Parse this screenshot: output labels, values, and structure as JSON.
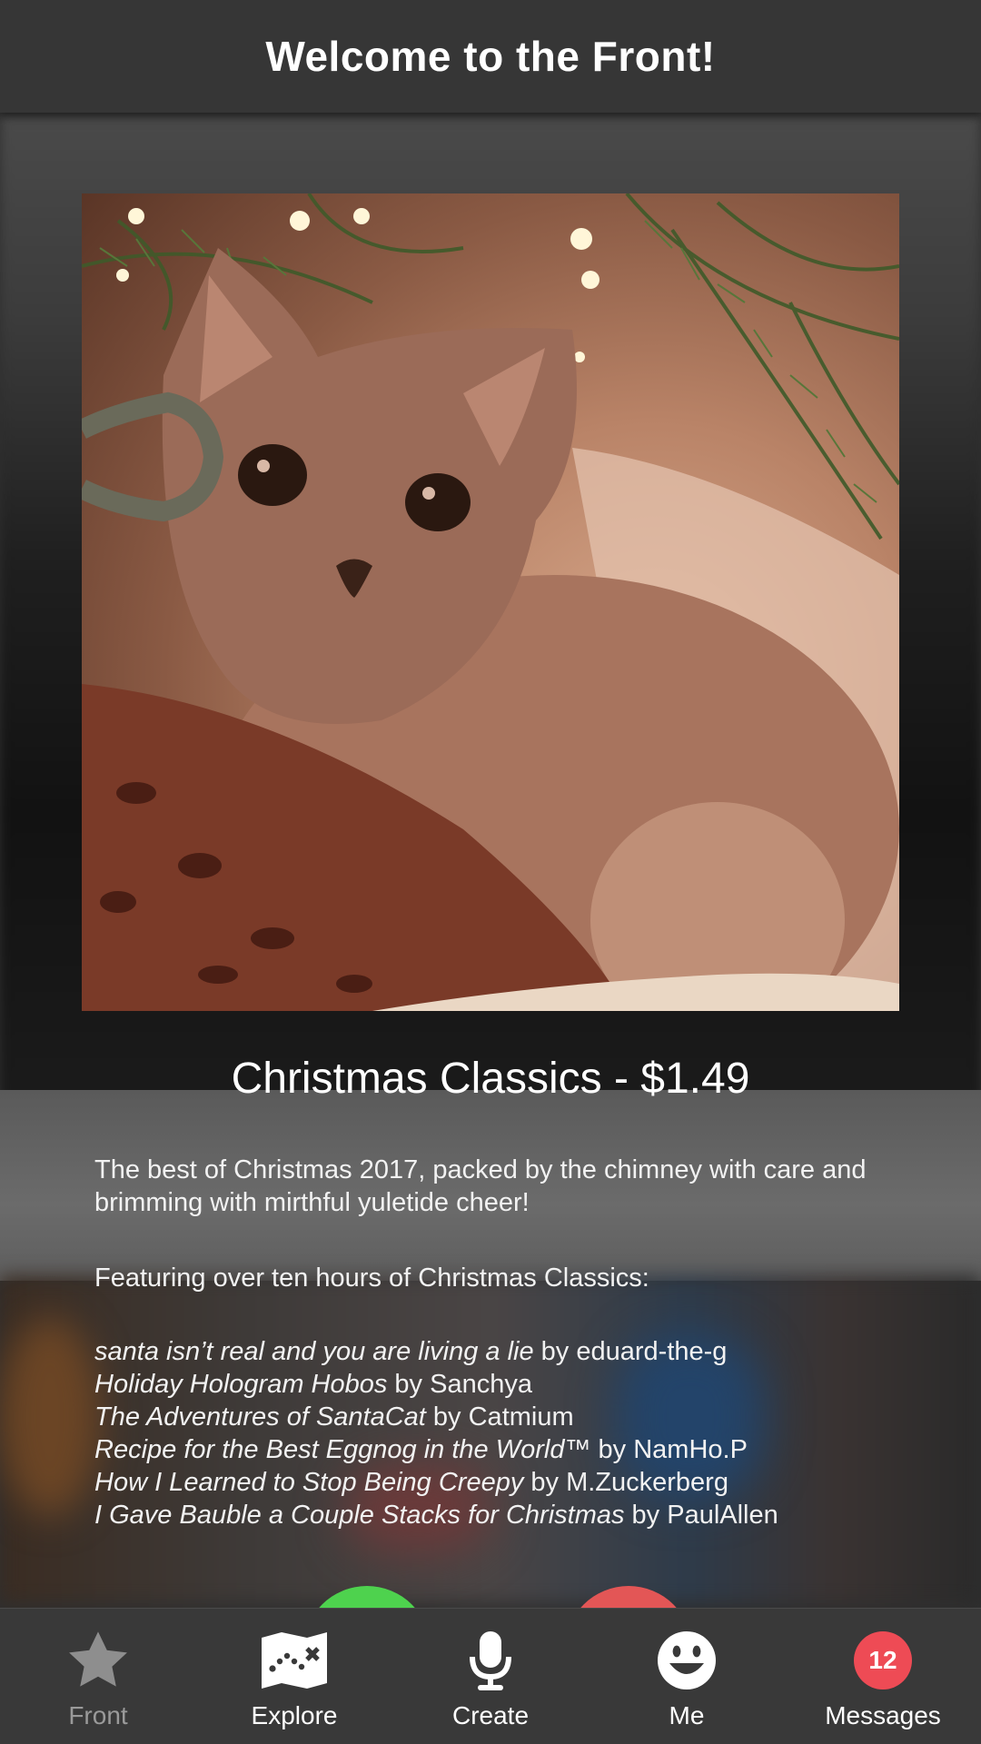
{
  "header": {
    "title": "Welcome to the Front!"
  },
  "product": {
    "title": "Christmas Classics - $1.49",
    "description_1": "The best of Christmas 2017, packed by the chimney with care and brimming with mirthful yuletide cheer!",
    "description_2": "Featuring over ten hours of Christmas Classics:",
    "tracks": [
      {
        "title": "santa isn’t real and you are living a lie",
        "by": " by eduard-the-g"
      },
      {
        "title": "Holiday Hologram Hobos",
        "by": " by Sanchya"
      },
      {
        "title": "The Adventures of SantaCat",
        "by": " by Catmium"
      },
      {
        "title": "Recipe for the Best Eggnog in the World™",
        "by": " by NamHo.P"
      },
      {
        "title": "How I Learned to Stop Being Creepy",
        "by": " by M.Zuckerberg"
      },
      {
        "title": "I Gave Bauble a Couple Stacks for Christmas",
        "by": " by PaulAllen"
      }
    ]
  },
  "tabs": [
    {
      "label": "Front",
      "icon": "star-icon",
      "active": true
    },
    {
      "label": "Explore",
      "icon": "treasure-map-icon"
    },
    {
      "label": "Create",
      "icon": "microphone-icon"
    },
    {
      "label": "Me",
      "icon": "smiley-face-icon"
    },
    {
      "label": "Messages",
      "icon": "messages-badge",
      "badge": "12"
    }
  ],
  "colors": {
    "header_bg": "#363636",
    "tabbar_bg": "#393939",
    "badge": "#ee4b55",
    "accept": "#4ed24e",
    "reject": "#e35656"
  }
}
